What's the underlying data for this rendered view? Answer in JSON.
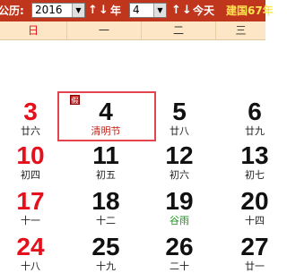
{
  "toolbar": {
    "calendar_label": "公历:",
    "year_value": "2016",
    "year_label": "年",
    "month_value": "4",
    "today_label": "今天",
    "era_label": "建国67年",
    "prev_arrow": "↑",
    "next_arrow": "↓",
    "select_arrow": "▼"
  },
  "weekdays": [
    "日",
    "一",
    "二",
    "三"
  ],
  "selected_badge": "假",
  "weeks": [
    [
      {
        "num": "3",
        "lunar": "廿六",
        "weekday": "sun"
      },
      {
        "num": "4",
        "lunar": "清明节",
        "lunar_color": "#c0241c",
        "selected": true
      },
      {
        "num": "5",
        "lunar": "廿八"
      },
      {
        "num": "6",
        "lunar": "廿九"
      }
    ],
    [
      {
        "num": "10",
        "lunar": "初四",
        "weekday": "sun"
      },
      {
        "num": "11",
        "lunar": "初五"
      },
      {
        "num": "12",
        "lunar": "初六"
      },
      {
        "num": "13",
        "lunar": "初七"
      }
    ],
    [
      {
        "num": "17",
        "lunar": "十一",
        "weekday": "sun"
      },
      {
        "num": "18",
        "lunar": "十二"
      },
      {
        "num": "19",
        "lunar": "谷雨",
        "lunar_color": "#1a9a1a"
      },
      {
        "num": "20",
        "lunar": "十四"
      }
    ],
    [
      {
        "num": "24",
        "lunar": "十八",
        "weekday": "sun"
      },
      {
        "num": "25",
        "lunar": "十九"
      },
      {
        "num": "26",
        "lunar": "二十"
      },
      {
        "num": "27",
        "lunar": "廿一"
      }
    ]
  ]
}
